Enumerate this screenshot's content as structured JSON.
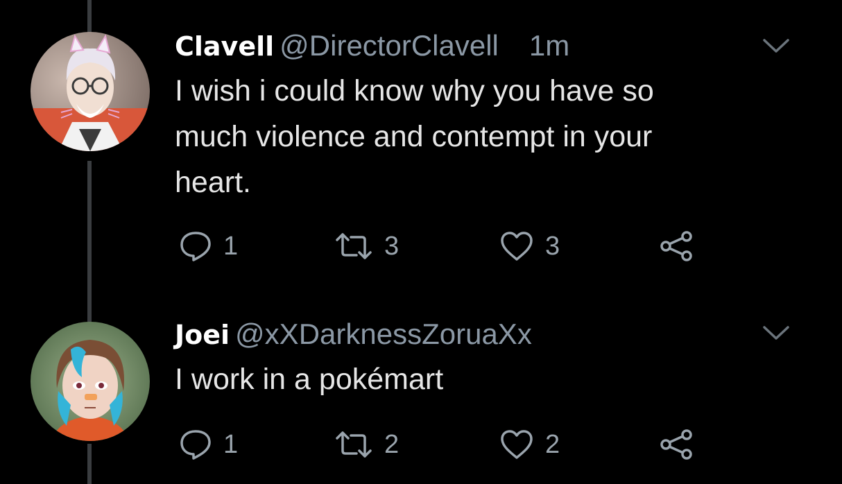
{
  "tweets": [
    {
      "name": "Clavell",
      "handle": "@DirectorClavell",
      "time": "1m",
      "text_lines": [
        "I wish i could know why you have so",
        "much violence and contempt in your",
        "heart."
      ],
      "replies": "1",
      "retweets": "3",
      "likes": "3"
    },
    {
      "name": "Joei",
      "handle": "@xXDarknessZoruaXx",
      "time": "",
      "text_lines": [
        "I work in a pokémart"
      ],
      "replies": "1",
      "retweets": "2",
      "likes": "2"
    }
  ],
  "icons": {
    "reply": "reply-icon",
    "retweet": "retweet-icon",
    "like": "heart-icon",
    "share": "share-icon",
    "more": "chevron-down-icon"
  },
  "colors": {
    "background": "#000000",
    "name": "#ffffff",
    "muted": "#8b98a5",
    "text": "#e6e6e6",
    "thread_line": "#3a3d40"
  }
}
